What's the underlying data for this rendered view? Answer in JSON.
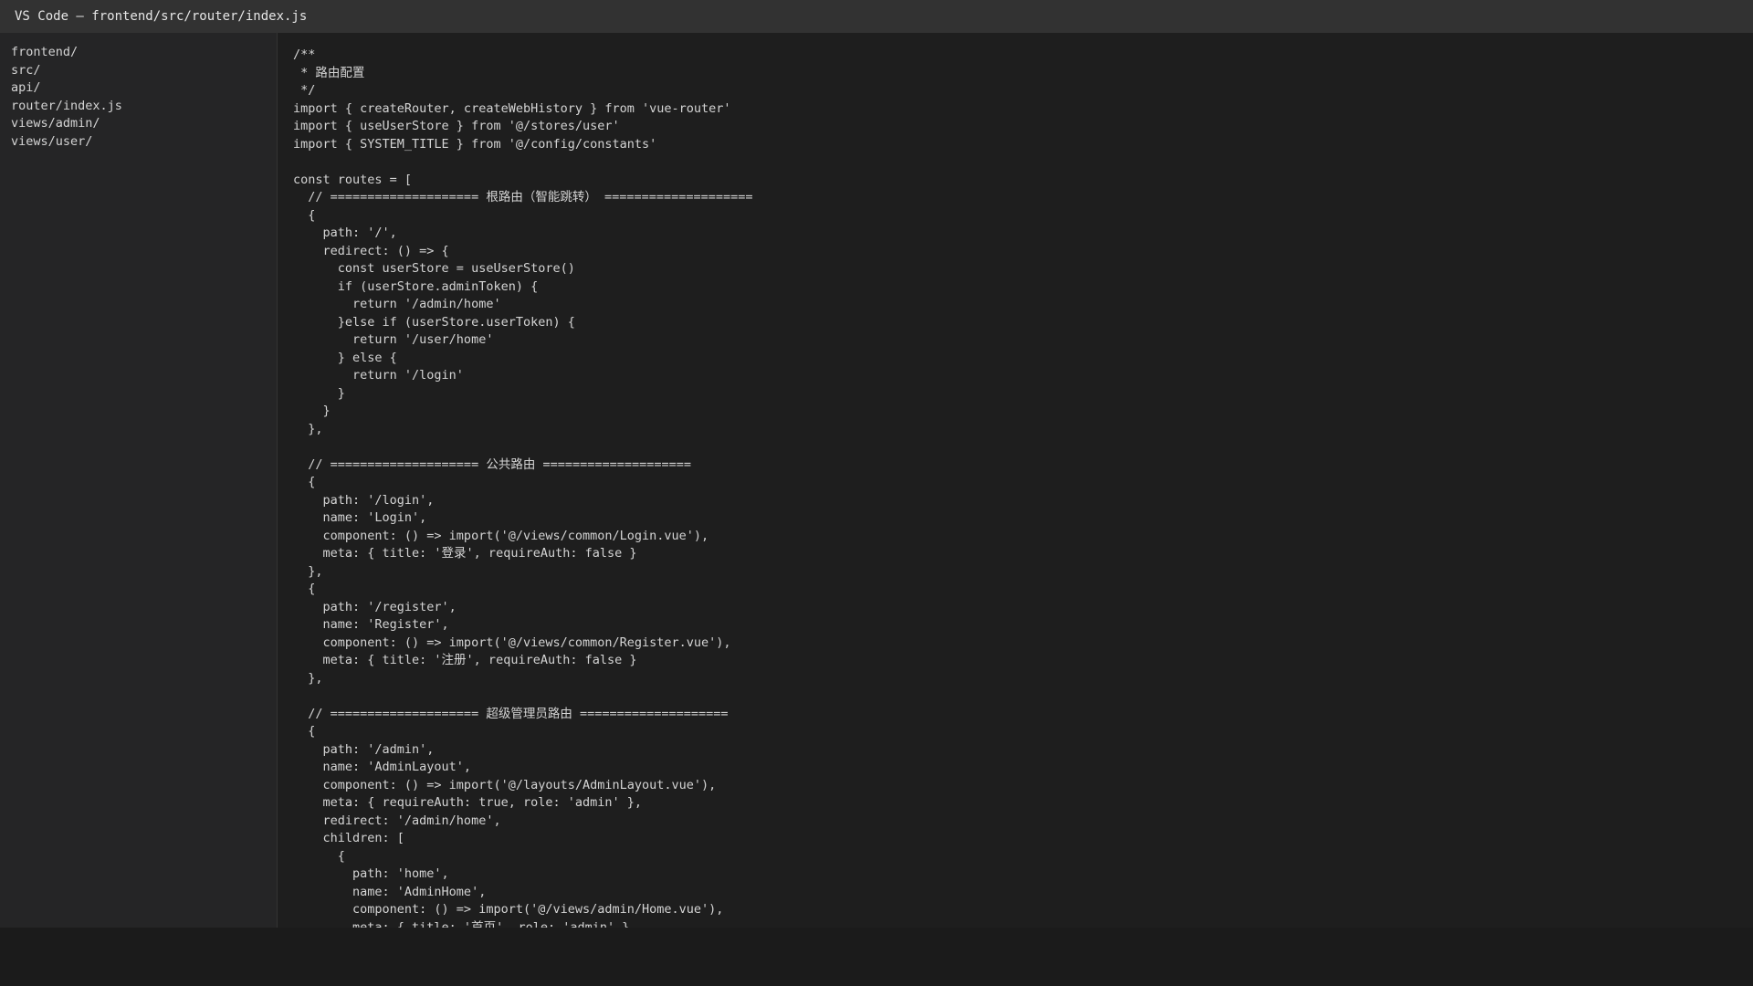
{
  "window": {
    "title": "VS Code — frontend/src/router/index.js"
  },
  "explorer": {
    "items": [
      "frontend/",
      "src/",
      "api/",
      "router/index.js",
      "views/admin/",
      "views/user/"
    ]
  },
  "editor": {
    "lines": [
      "/**",
      " * 路由配置",
      " */",
      "import { createRouter, createWebHistory } from 'vue-router'",
      "import { useUserStore } from '@/stores/user'",
      "import { SYSTEM_TITLE } from '@/config/constants'",
      "",
      "const routes = [",
      "  // ==================== 根路由（智能跳转） ====================",
      "  {",
      "    path: '/',",
      "    redirect: () => {",
      "      const userStore = useUserStore()",
      "      if (userStore.adminToken) {",
      "        return '/admin/home'",
      "      }else if (userStore.userToken) {",
      "        return '/user/home'",
      "      } else {",
      "        return '/login'",
      "      }",
      "    }",
      "  },",
      "",
      "  // ==================== 公共路由 ====================",
      "  {",
      "    path: '/login',",
      "    name: 'Login',",
      "    component: () => import('@/views/common/Login.vue'),",
      "    meta: { title: '登录', requireAuth: false }",
      "  },",
      "  {",
      "    path: '/register',",
      "    name: 'Register',",
      "    component: () => import('@/views/common/Register.vue'),",
      "    meta: { title: '注册', requireAuth: false }",
      "  },",
      "",
      "  // ==================== 超级管理员路由 ====================",
      "  {",
      "    path: '/admin',",
      "    name: 'AdminLayout',",
      "    component: () => import('@/layouts/AdminLayout.vue'),",
      "    meta: { requireAuth: true, role: 'admin' },",
      "    redirect: '/admin/home',",
      "    children: [",
      "      {",
      "        path: 'home',",
      "        name: 'AdminHome',",
      "        component: () => import('@/views/admin/Home.vue'),",
      "        meta: { title: '首页', role: 'admin' }"
    ]
  }
}
